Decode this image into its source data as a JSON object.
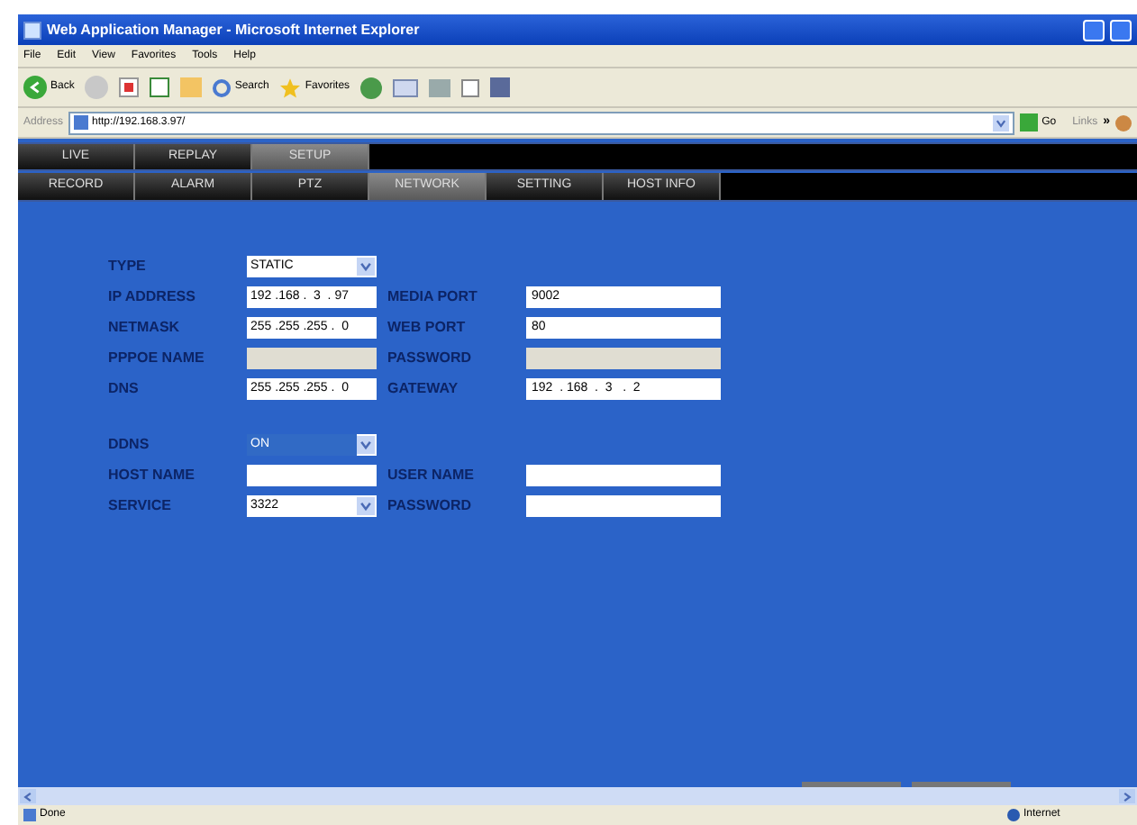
{
  "window": {
    "title": "Web Application Manager - Microsoft Internet Explorer"
  },
  "menu": [
    "File",
    "Edit",
    "View",
    "Favorites",
    "Tools",
    "Help"
  ],
  "toolbar": {
    "back": "Back",
    "search": "Search",
    "favorites": "Favorites"
  },
  "address": {
    "label": "Address",
    "url": "http://192.168.3.97/",
    "go": "Go",
    "links": "Links",
    "more": "»"
  },
  "main_tabs": [
    {
      "label": "LIVE",
      "selected": false
    },
    {
      "label": "REPLAY",
      "selected": false
    },
    {
      "label": "SETUP",
      "selected": true
    }
  ],
  "sub_tabs": [
    {
      "label": "RECORD",
      "selected": false
    },
    {
      "label": "ALARM",
      "selected": false
    },
    {
      "label": "PTZ",
      "selected": false
    },
    {
      "label": "NETWORK",
      "selected": true
    },
    {
      "label": "SETTING",
      "selected": false
    },
    {
      "label": "HOST INFO",
      "selected": false
    }
  ],
  "sections": [
    {
      "rows": [
        {
          "left": {
            "label": "TYPE",
            "kind": "select",
            "value": "STATIC"
          }
        },
        {
          "left": {
            "label": "IP ADDRESS",
            "kind": "text",
            "value": "192 .168 .  3  . 97"
          },
          "right": {
            "label": "MEDIA PORT",
            "kind": "text",
            "value": "9002"
          }
        },
        {
          "left": {
            "label": "NETMASK",
            "kind": "text",
            "value": "255 .255 .255 .  0"
          },
          "right": {
            "label": "WEB PORT",
            "kind": "text",
            "value": "80"
          }
        },
        {
          "left": {
            "label": "PPPOE NAME",
            "kind": "disabled"
          },
          "right": {
            "label": "PASSWORD",
            "kind": "disabled"
          }
        },
        {
          "left": {
            "label": "DNS",
            "kind": "text",
            "value": "255 .255 .255 .  0"
          },
          "right": {
            "label": "GATEWAY",
            "kind": "text",
            "value": "192  . 168  .  3   .  2"
          }
        }
      ]
    },
    {
      "rows": [
        {
          "left": {
            "label": "DDNS",
            "kind": "select",
            "value": "ON",
            "highlighted": true
          }
        },
        {
          "left": {
            "label": "HOST NAME",
            "kind": "text"
          },
          "right": {
            "label": "USER NAME",
            "kind": "text"
          }
        },
        {
          "left": {
            "label": "SERVICE",
            "kind": "select",
            "value": "3322"
          },
          "right": {
            "label": "PASSWORD",
            "kind": "text"
          }
        }
      ]
    }
  ],
  "status_bar": {
    "text": "Done",
    "zone": "Internet"
  }
}
